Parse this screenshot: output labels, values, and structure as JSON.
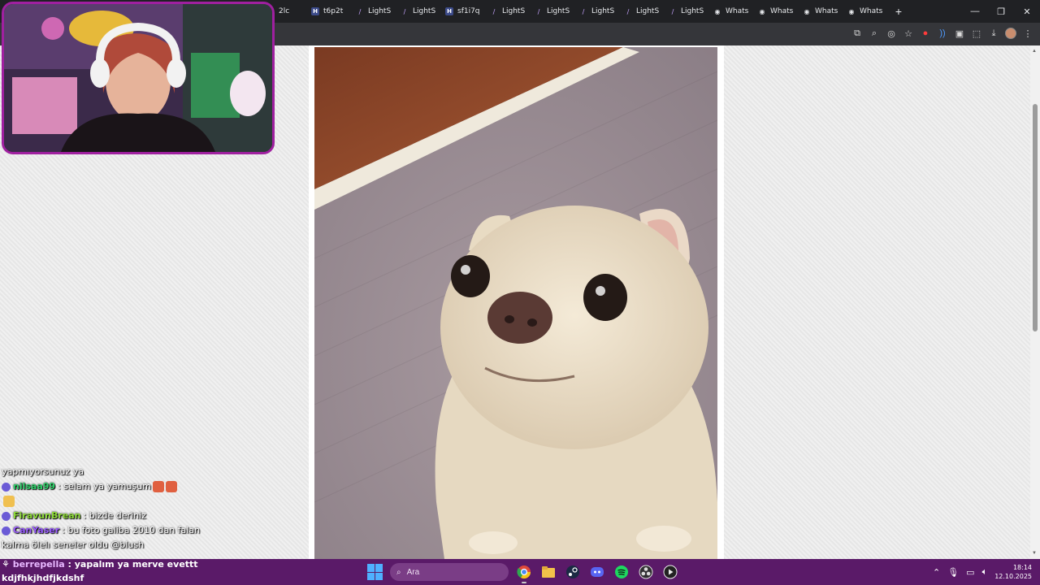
{
  "browser": {
    "tabs": [
      {
        "label": "2lc",
        "icon": "vimeo-icon"
      },
      {
        "label": "t6p2t",
        "icon": "h-icon"
      },
      {
        "label": "LightS",
        "icon": "feather-icon"
      },
      {
        "label": "LightS",
        "icon": "feather-icon"
      },
      {
        "label": "sf1i7q",
        "icon": "h-icon"
      },
      {
        "label": "LightS",
        "icon": "feather-icon"
      },
      {
        "label": "LightS",
        "icon": "feather-icon"
      },
      {
        "label": "LightS",
        "icon": "feather-icon"
      },
      {
        "label": "LightS",
        "icon": "feather-icon"
      },
      {
        "label": "LightS",
        "icon": "feather-icon"
      },
      {
        "label": "Whats",
        "icon": "globe-icon"
      },
      {
        "label": "Whats",
        "icon": "globe-icon"
      },
      {
        "label": "Whats",
        "icon": "globe-icon"
      },
      {
        "label": "Whats",
        "icon": "globe-icon"
      }
    ],
    "new_tab_label": "+",
    "window_controls": {
      "minimize": "—",
      "restore": "❐",
      "close": "✕"
    }
  },
  "chat": {
    "messages": [
      {
        "user": "",
        "text": "yapmıyorsunuz ya",
        "color": "#ffffff"
      },
      {
        "user": "nilsaa99",
        "text": ": selam ya yamuşum",
        "color": "#2fd06a"
      },
      {
        "user": "FiravunBrean",
        "text": ": bizde deriniz",
        "color": "#8fdc3a"
      },
      {
        "user": "CanYaser",
        "text": ": bu foto galiba 2010 dan falan",
        "color": "#9a5cff"
      },
      {
        "user": "",
        "text": "kalma ölelı seneler oldu @blush",
        "color": "#ffffff"
      }
    ],
    "bottom_messages": [
      {
        "user": "berrepella",
        "text": ": yapalım ya merve evettt"
      },
      {
        "user": "",
        "text": "kdjfhkjhdfjkdshf"
      }
    ]
  },
  "taskbar": {
    "search_placeholder": "Ara",
    "time": "18:14",
    "date": "12.10.2025",
    "apps": [
      "chrome-icon",
      "file-explorer-icon",
      "steam-icon",
      "discord-icon",
      "spotify-icon",
      "obs-icon",
      "media-player-icon"
    ]
  },
  "colors": {
    "taskbar": "#5a1a68",
    "webcam_border": "#a020a0",
    "tabbar": "#202124"
  }
}
